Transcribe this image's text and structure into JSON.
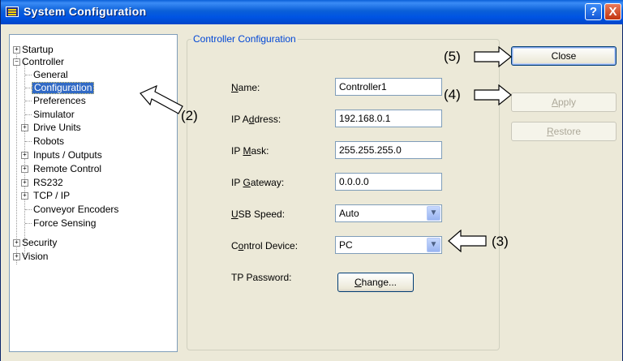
{
  "window": {
    "title": "System Configuration",
    "help_label": "?",
    "close_label": "X"
  },
  "tree": {
    "startup": "Startup",
    "controller": "Controller",
    "general": "General",
    "configuration": "Configuration",
    "preferences": "Preferences",
    "simulator": "Simulator",
    "drive_units": "Drive Units",
    "robots": "Robots",
    "inputs_outputs": "Inputs / Outputs",
    "remote_control": "Remote Control",
    "rs232": "RS232",
    "tcpip": "TCP / IP",
    "conveyor_encoders": "Conveyor Encoders",
    "force_sensing": "Force Sensing",
    "security": "Security",
    "vision": "Vision",
    "plus": "+",
    "minus": "−"
  },
  "panel": {
    "group_title": "Controller Configuration",
    "name_label_pre": "",
    "name_label_u": "N",
    "name_label_post": "ame:",
    "name_value": "Controller1",
    "ip_label_pre": "IP A",
    "ip_label_u": "d",
    "ip_label_post": "dress:",
    "ip_value": "192.168.0.1",
    "mask_label_pre": "IP ",
    "mask_label_u": "M",
    "mask_label_post": "ask:",
    "mask_value": "255.255.255.0",
    "gateway_label_pre": "IP ",
    "gateway_label_u": "G",
    "gateway_label_post": "ateway:",
    "gateway_value": "0.0.0.0",
    "usb_label_pre": "",
    "usb_label_u": "U",
    "usb_label_post": "SB Speed:",
    "usb_value": "Auto",
    "device_label_pre": "C",
    "device_label_u": "o",
    "device_label_post": "ntrol Device:",
    "device_value": "PC",
    "tp_label": "TP Password:",
    "change_pre": "",
    "change_u": "C",
    "change_post": "hange..."
  },
  "buttons": {
    "close": "Close",
    "apply_u": "A",
    "apply_post": "pply",
    "restore_u": "R",
    "restore_post": "estore"
  },
  "callouts": {
    "c2": "(2)",
    "c3": "(3)",
    "c4": "(4)",
    "c5": "(5)"
  },
  "dropdown_glyph": "▼"
}
